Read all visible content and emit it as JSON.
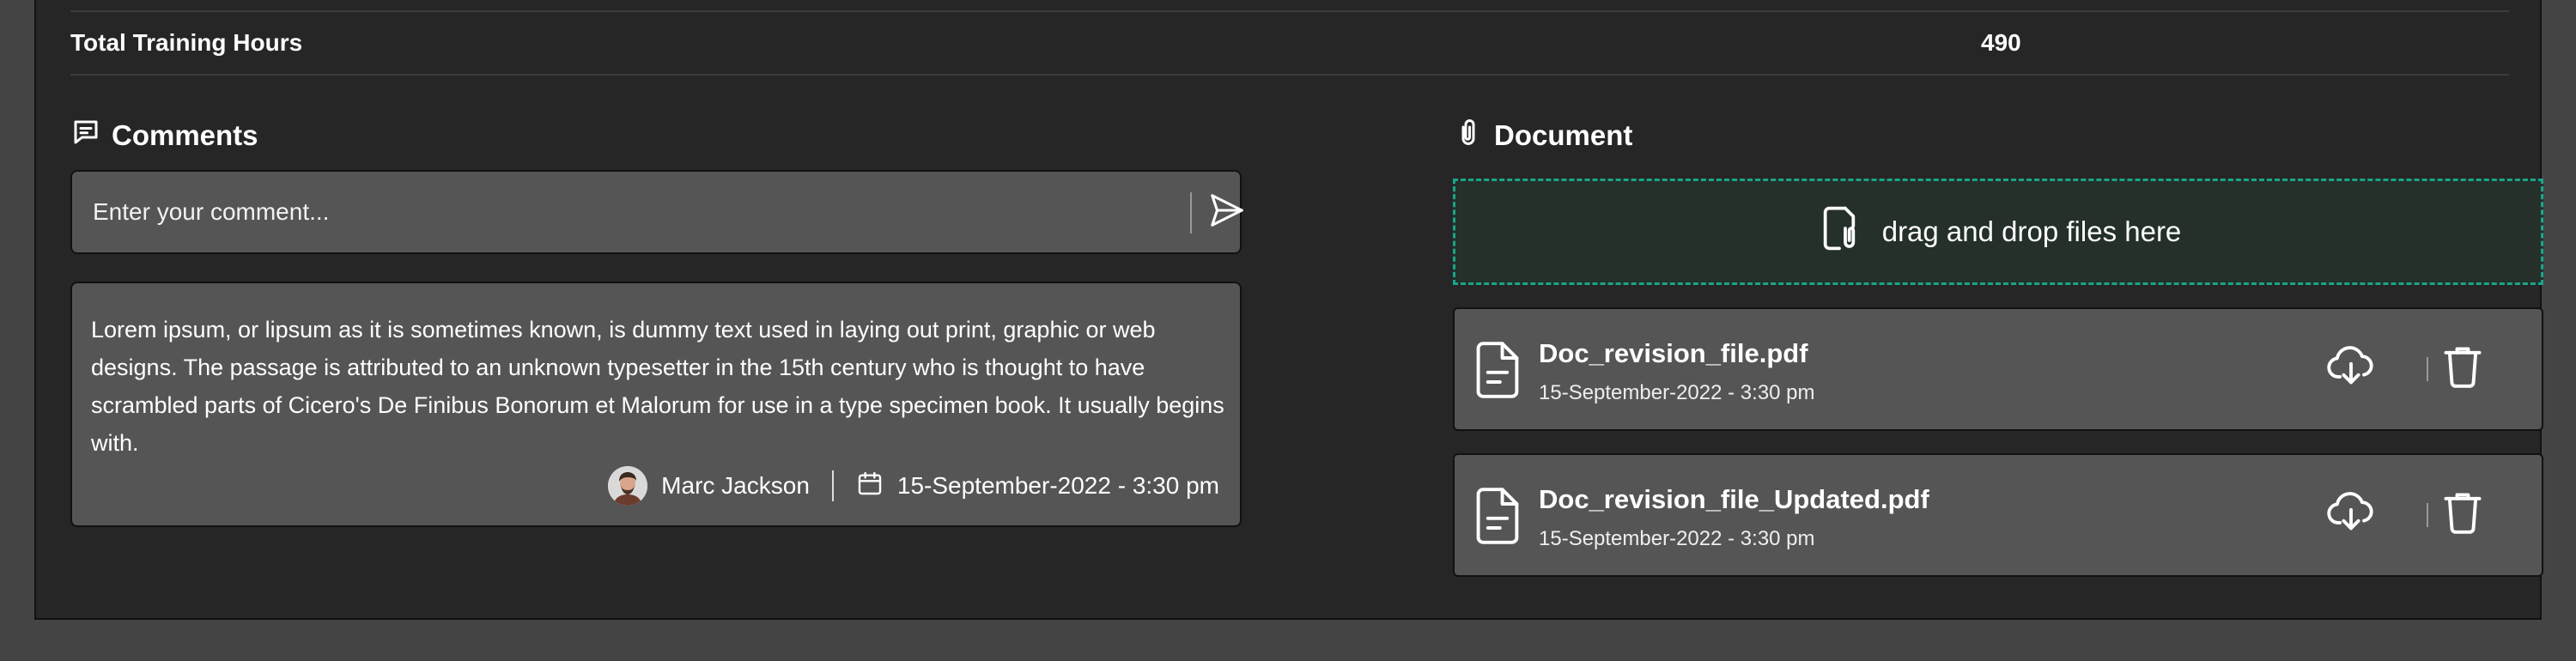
{
  "summary": {
    "label": "Total Training Hours",
    "value": "490"
  },
  "comments": {
    "title": "Comments",
    "input_placeholder": "Enter your comment...",
    "items": [
      {
        "text": "Lorem ipsum, or lipsum as it is sometimes known, is dummy text used in laying out print, graphic or web designs. The passage is attributed to an unknown typesetter in the 15th century who is thought to have scrambled parts of Cicero's De Finibus Bonorum et Malorum for use in a type specimen book. It usually begins with.",
        "author": "Marc Jackson",
        "date": "15-September-2022 - 3:30 pm"
      }
    ]
  },
  "documents": {
    "title": "Document",
    "dropzone_label": "drag and drop files here",
    "files": [
      {
        "name": "Doc_revision_file.pdf",
        "date": "15-September-2022 - 3:30 pm"
      },
      {
        "name": "Doc_revision_file_Updated.pdf",
        "date": "15-September-2022 - 3:30 pm"
      }
    ]
  },
  "icons": {
    "comments": "comment-icon",
    "send": "send-icon",
    "calendar": "calendar-icon",
    "attachment": "paperclip-icon",
    "upload": "file-attach-icon",
    "file": "document-icon",
    "download": "cloud-download-icon",
    "delete": "trash-icon"
  },
  "colors": {
    "background": "#444444",
    "panel": "#262626",
    "card": "#555555",
    "dropzone_border": "#1aa58a",
    "dropzone_fill": "#243029"
  }
}
